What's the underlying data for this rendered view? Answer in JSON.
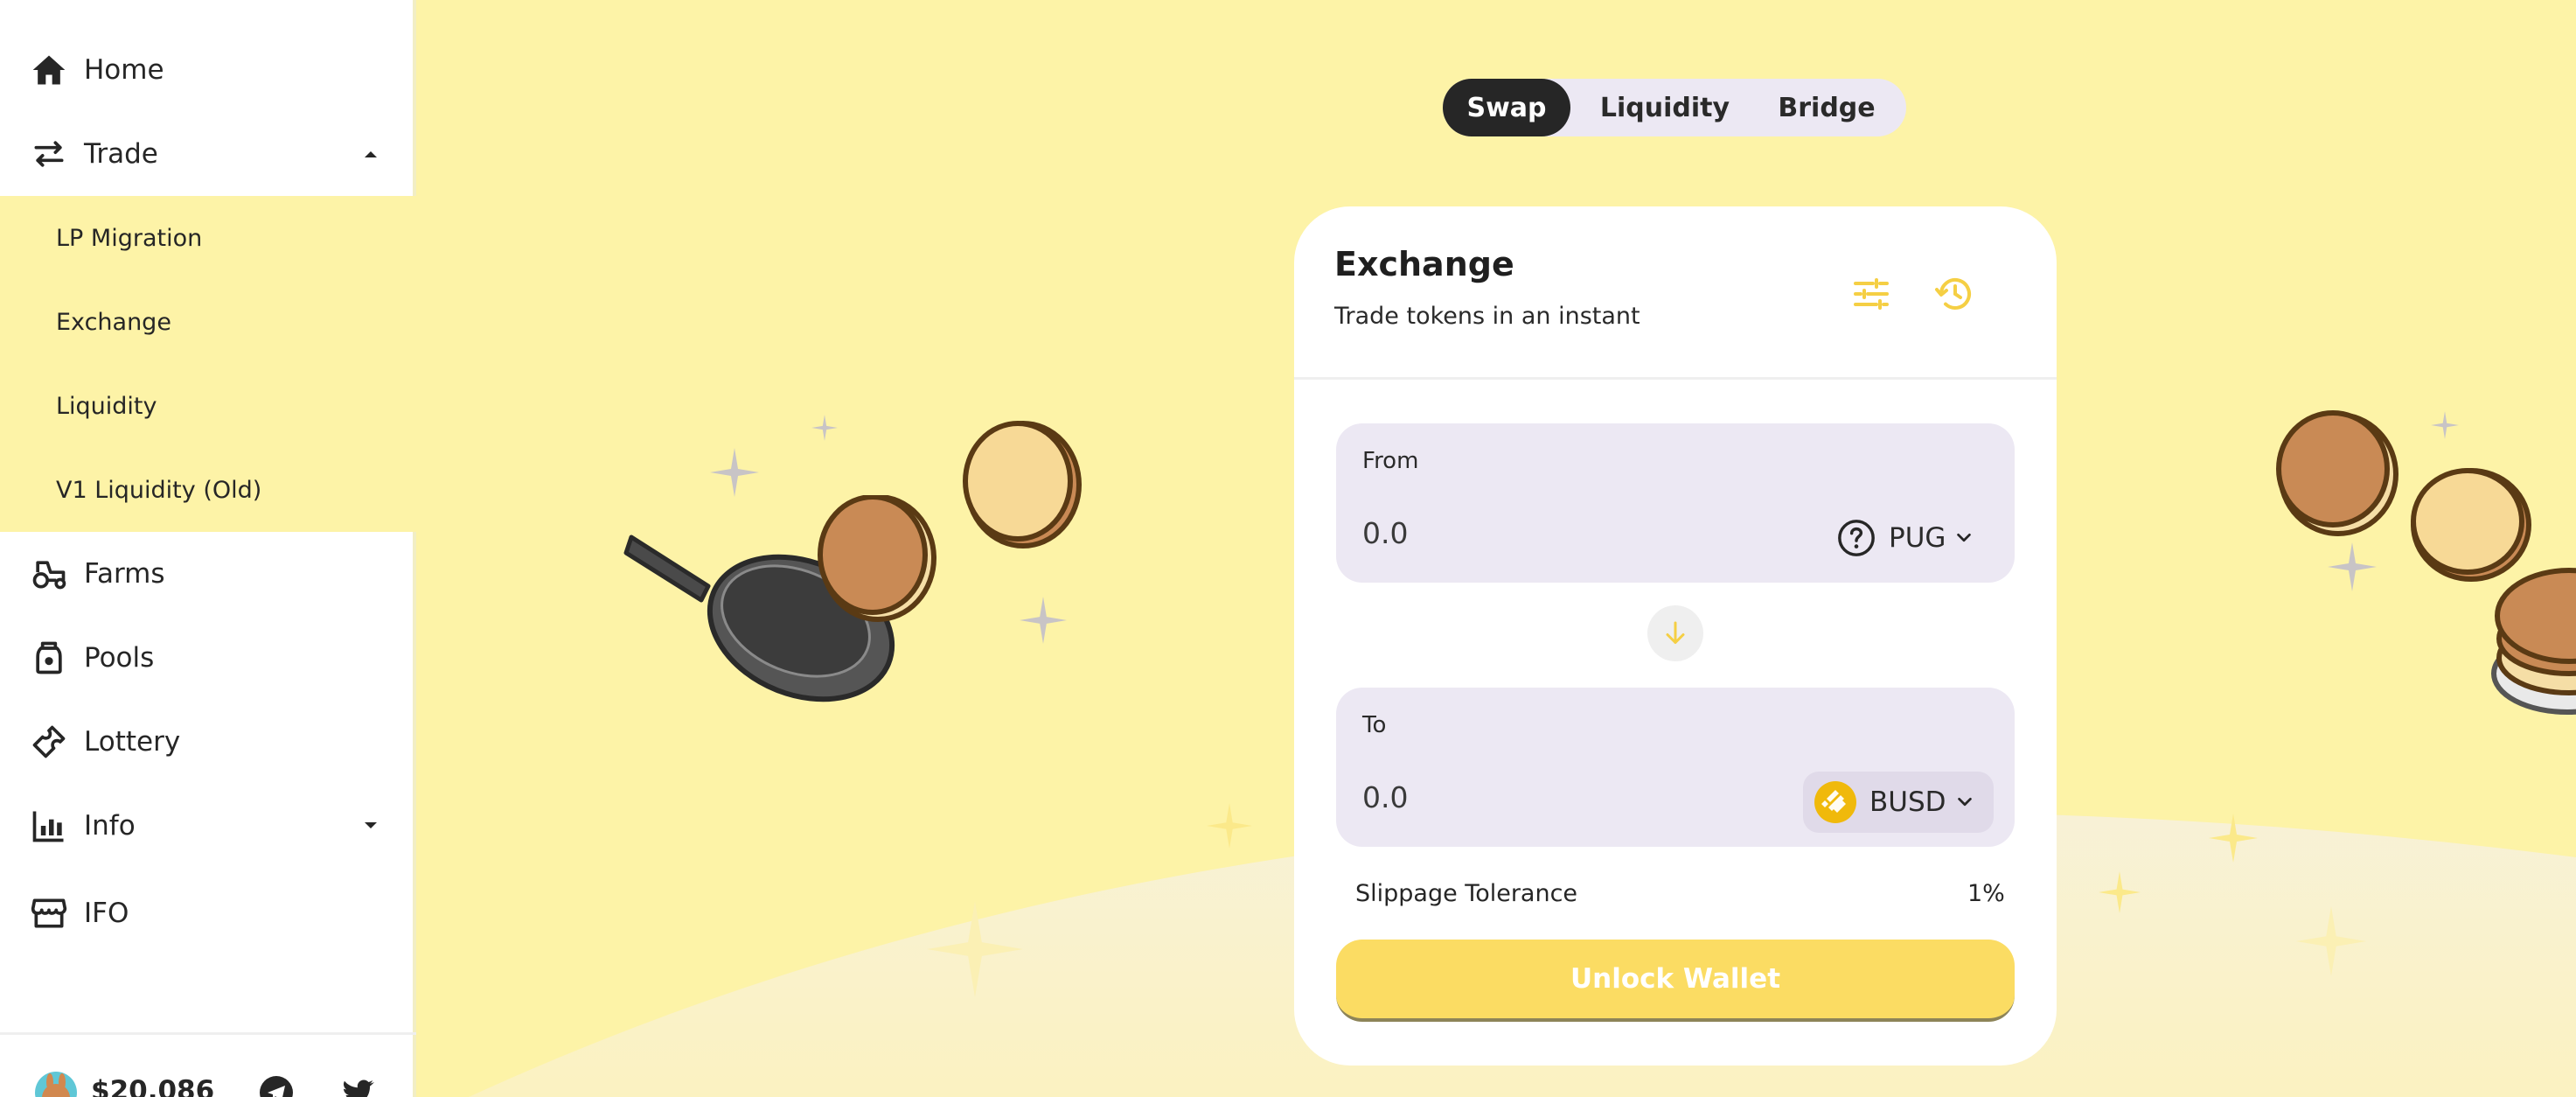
{
  "sidebar": {
    "items": [
      {
        "label": "Home",
        "icon": "home-icon"
      },
      {
        "label": "Trade",
        "icon": "trade-arrows-icon"
      },
      {
        "label": "Farms",
        "icon": "tractor-icon"
      },
      {
        "label": "Pools",
        "icon": "jar-icon"
      },
      {
        "label": "Lottery",
        "icon": "ticket-icon"
      },
      {
        "label": "Info",
        "icon": "chart-icon"
      },
      {
        "label": "IFO",
        "icon": "store-icon"
      }
    ],
    "trade_subitems": [
      {
        "label": "LP Migration"
      },
      {
        "label": "Exchange"
      },
      {
        "label": "Liquidity"
      },
      {
        "label": "V1 Liquidity (Old)"
      }
    ],
    "footer": {
      "price": "$20.086"
    }
  },
  "tabs": [
    {
      "label": "Swap",
      "active": true
    },
    {
      "label": "Liquidity",
      "active": false
    },
    {
      "label": "Bridge",
      "active": false
    }
  ],
  "exchange": {
    "title": "Exchange",
    "subtitle": "Trade tokens in an instant",
    "from": {
      "label": "From",
      "amount": "0.0",
      "token": "PUG",
      "token_icon": "question-circle-icon"
    },
    "to": {
      "label": "To",
      "amount": "0.0",
      "token": "BUSD",
      "token_icon": "busd-icon"
    },
    "slippage_label": "Slippage Tolerance",
    "slippage_value": "1%",
    "unlock_button": "Unlock Wallet"
  },
  "colors": {
    "background": "#fdf3a7",
    "accent": "#fbdc63",
    "panel": "#ece8f3",
    "dark": "#262626"
  }
}
